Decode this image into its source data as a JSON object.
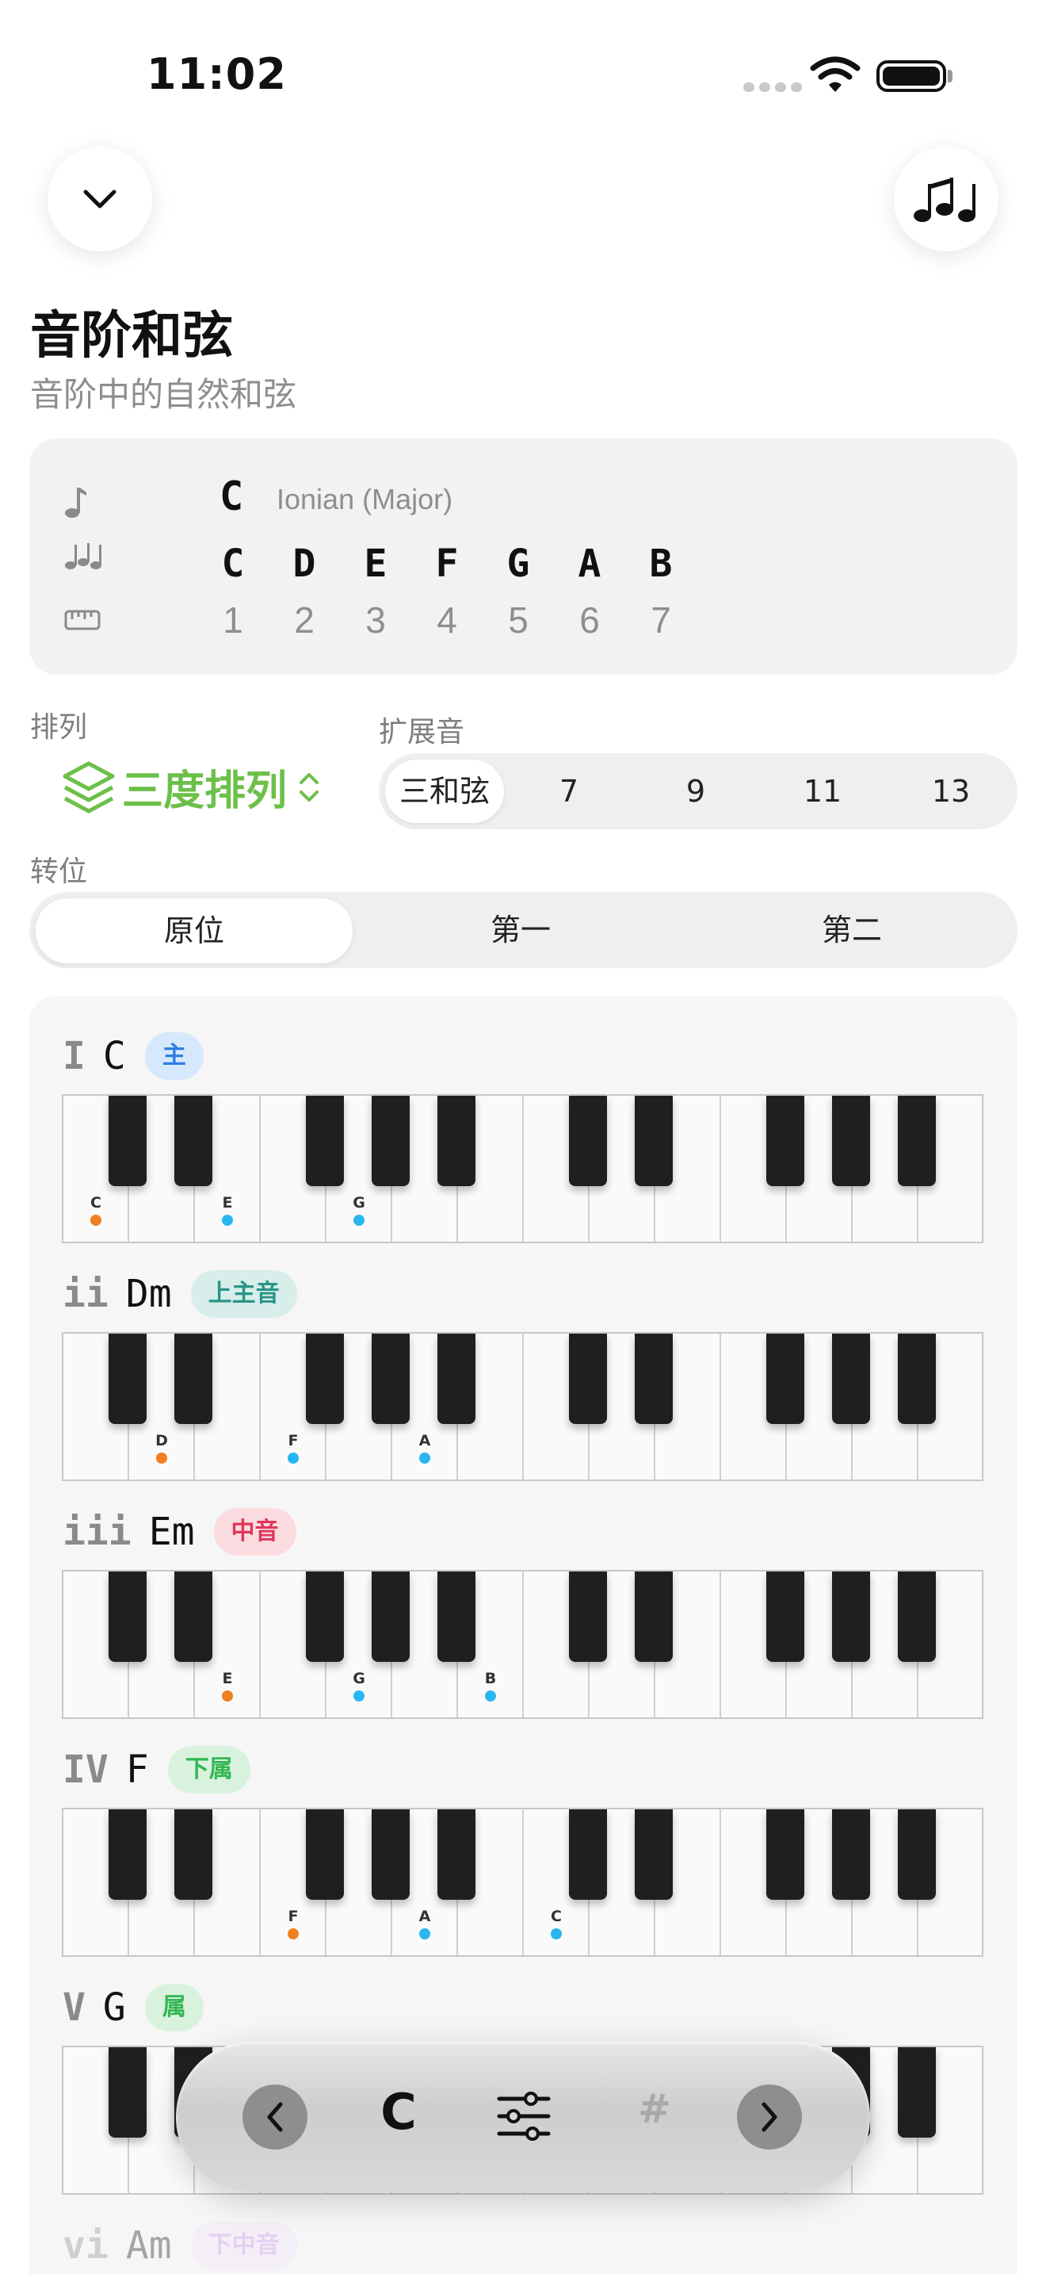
{
  "status_bar": {
    "time": "11:02"
  },
  "header": {
    "title": "音阶和弦",
    "subtitle": "音阶中的自然和弦"
  },
  "scale": {
    "key": "C",
    "mode": "Ionian (Major)",
    "notes": [
      "C",
      "D",
      "E",
      "F",
      "G",
      "A",
      "B"
    ],
    "degrees": [
      "1",
      "2",
      "3",
      "4",
      "5",
      "6",
      "7"
    ]
  },
  "arrangement": {
    "label": "排列",
    "value": "三度排列"
  },
  "extensions": {
    "label": "扩展音",
    "options": [
      "三和弦",
      "7",
      "9",
      "11",
      "13"
    ],
    "selected": "三和弦"
  },
  "inversion": {
    "label": "转位",
    "options": [
      "原位",
      "第一",
      "第二"
    ],
    "selected": "原位"
  },
  "colors": {
    "accent_green": "#6cc04a",
    "root_dot": "#f07f22",
    "tone_dot": "#29b6f0"
  },
  "chords": [
    {
      "roman": "I",
      "name": "C",
      "badge": "主",
      "badge_bg": "#d6e8fb",
      "badge_fg": "#2f7fe0",
      "notes": [
        "C",
        "E",
        "G"
      ]
    },
    {
      "roman": "ii",
      "name": "Dm",
      "badge": "上主音",
      "badge_bg": "#d7eeea",
      "badge_fg": "#2a9488",
      "notes": [
        "D",
        "F",
        "A"
      ]
    },
    {
      "roman": "iii",
      "name": "Em",
      "badge": "中音",
      "badge_bg": "#fadbe0",
      "badge_fg": "#e0365a",
      "notes": [
        "E",
        "G",
        "B"
      ]
    },
    {
      "roman": "IV",
      "name": "F",
      "badge": "下属",
      "badge_bg": "#d9f2de",
      "badge_fg": "#33b653",
      "notes": [
        "F",
        "A",
        "C"
      ]
    },
    {
      "roman": "V",
      "name": "G",
      "badge": "属",
      "badge_bg": "#d9f2de",
      "badge_fg": "#33b653",
      "notes": []
    },
    {
      "roman": "vi",
      "name": "Am",
      "badge": "下中音",
      "badge_bg": "#f1e2fb",
      "badge_fg": "#c58ae8",
      "notes": []
    }
  ],
  "toolbar": {
    "key": "C",
    "sharp": "#",
    "icons": [
      "chevron-left-icon",
      "sliders-icon",
      "chevron-right-icon"
    ]
  }
}
